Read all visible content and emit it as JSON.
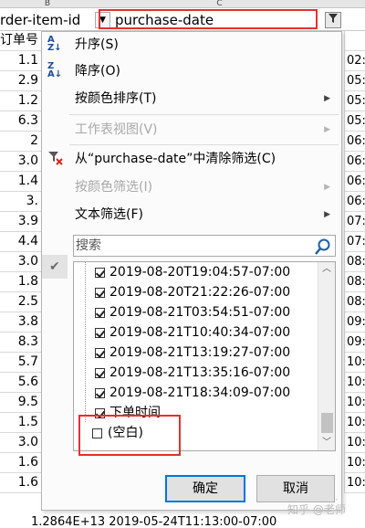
{
  "columns": {
    "b": "B",
    "c": "C"
  },
  "header_row": {
    "col_b": "rder-item-id",
    "col_c": "purchase-date",
    "filter_glyph": "funnel-icon"
  },
  "row_labels_a": [
    "订单号",
    "1.1",
    "2.9",
    "1.2",
    "6.3",
    "2",
    "3.0",
    "1.4",
    "3.",
    "3.9",
    "4.4",
    "3.0",
    "1.8",
    "2.5",
    "3.8",
    "8.3",
    "5.7",
    "5.6",
    "9.5",
    "1.5",
    "3.0",
    "1.6",
    "1.6"
  ],
  "row_labels_d": [
    "",
    "02:",
    "05:",
    "05:",
    "05:",
    "06:",
    "06:",
    "06:",
    "06:",
    "07:",
    "07:",
    "08:",
    "08:",
    "08:",
    "09:",
    "09:",
    "10:",
    "10:",
    "10:",
    "10:",
    "10:",
    "10:",
    "10:"
  ],
  "menu": {
    "sort_asc": "升序(S)",
    "sort_desc": "降序(O)",
    "sort_color": "按颜色排序(T)",
    "sheet_view": "工作表视图(V)",
    "clear_filter": "从“purchase-date”中清除筛选(C)",
    "color_filter": "按颜色筛选(I)",
    "text_filter": "文本筛选(F)"
  },
  "search": {
    "placeholder": "搜索"
  },
  "list_items": [
    {
      "label": "2019-08-20T19:04:57-07:00",
      "checked": true
    },
    {
      "label": "2019-08-20T21:22:26-07:00",
      "checked": true
    },
    {
      "label": "2019-08-21T03:54:51-07:00",
      "checked": true
    },
    {
      "label": "2019-08-21T10:40:34-07:00",
      "checked": true
    },
    {
      "label": "2019-08-21T13:19:27-07:00",
      "checked": true
    },
    {
      "label": "2019-08-21T13:35:16-07:00",
      "checked": true
    },
    {
      "label": "2019-08-21T18:34:09-07:00",
      "checked": true
    },
    {
      "label": "下单时间",
      "checked": true
    },
    {
      "label": "(空白)",
      "checked": false
    }
  ],
  "buttons": {
    "ok": "确定",
    "cancel": "取消"
  },
  "bottom_row_text": "1.2864E+13 2019-05-24T11:13:00-07:00",
  "watermark": "知乎 @老师",
  "colors": {
    "highlight": "#e0322e",
    "accent": "#0078d7"
  }
}
